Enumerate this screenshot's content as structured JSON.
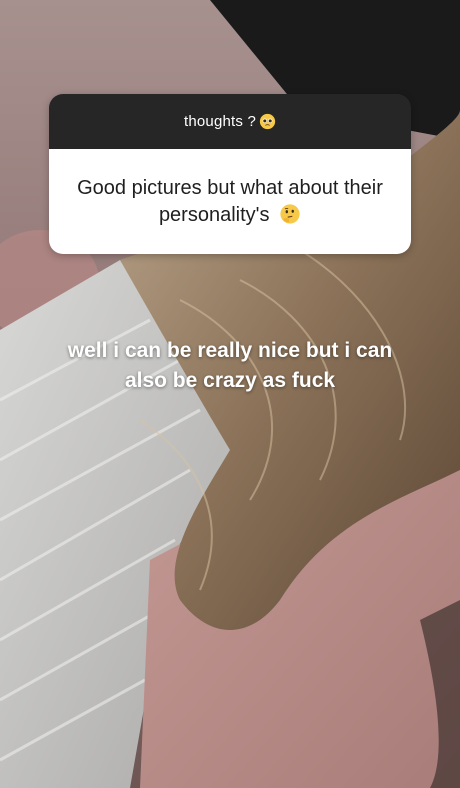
{
  "question_sticker": {
    "prompt": "thoughts ?",
    "prompt_emoji": "pleading-face-emoji",
    "answer": "Good pictures but what about their personality's",
    "answer_emoji": "thinking-face-emoji"
  },
  "caption": {
    "line1": "well i can be really nice but i can",
    "line2": "also be crazy as fuck"
  },
  "colors": {
    "header_bg": "#262626",
    "card_bg": "#ffffff",
    "caption_text": "#ffffff"
  }
}
